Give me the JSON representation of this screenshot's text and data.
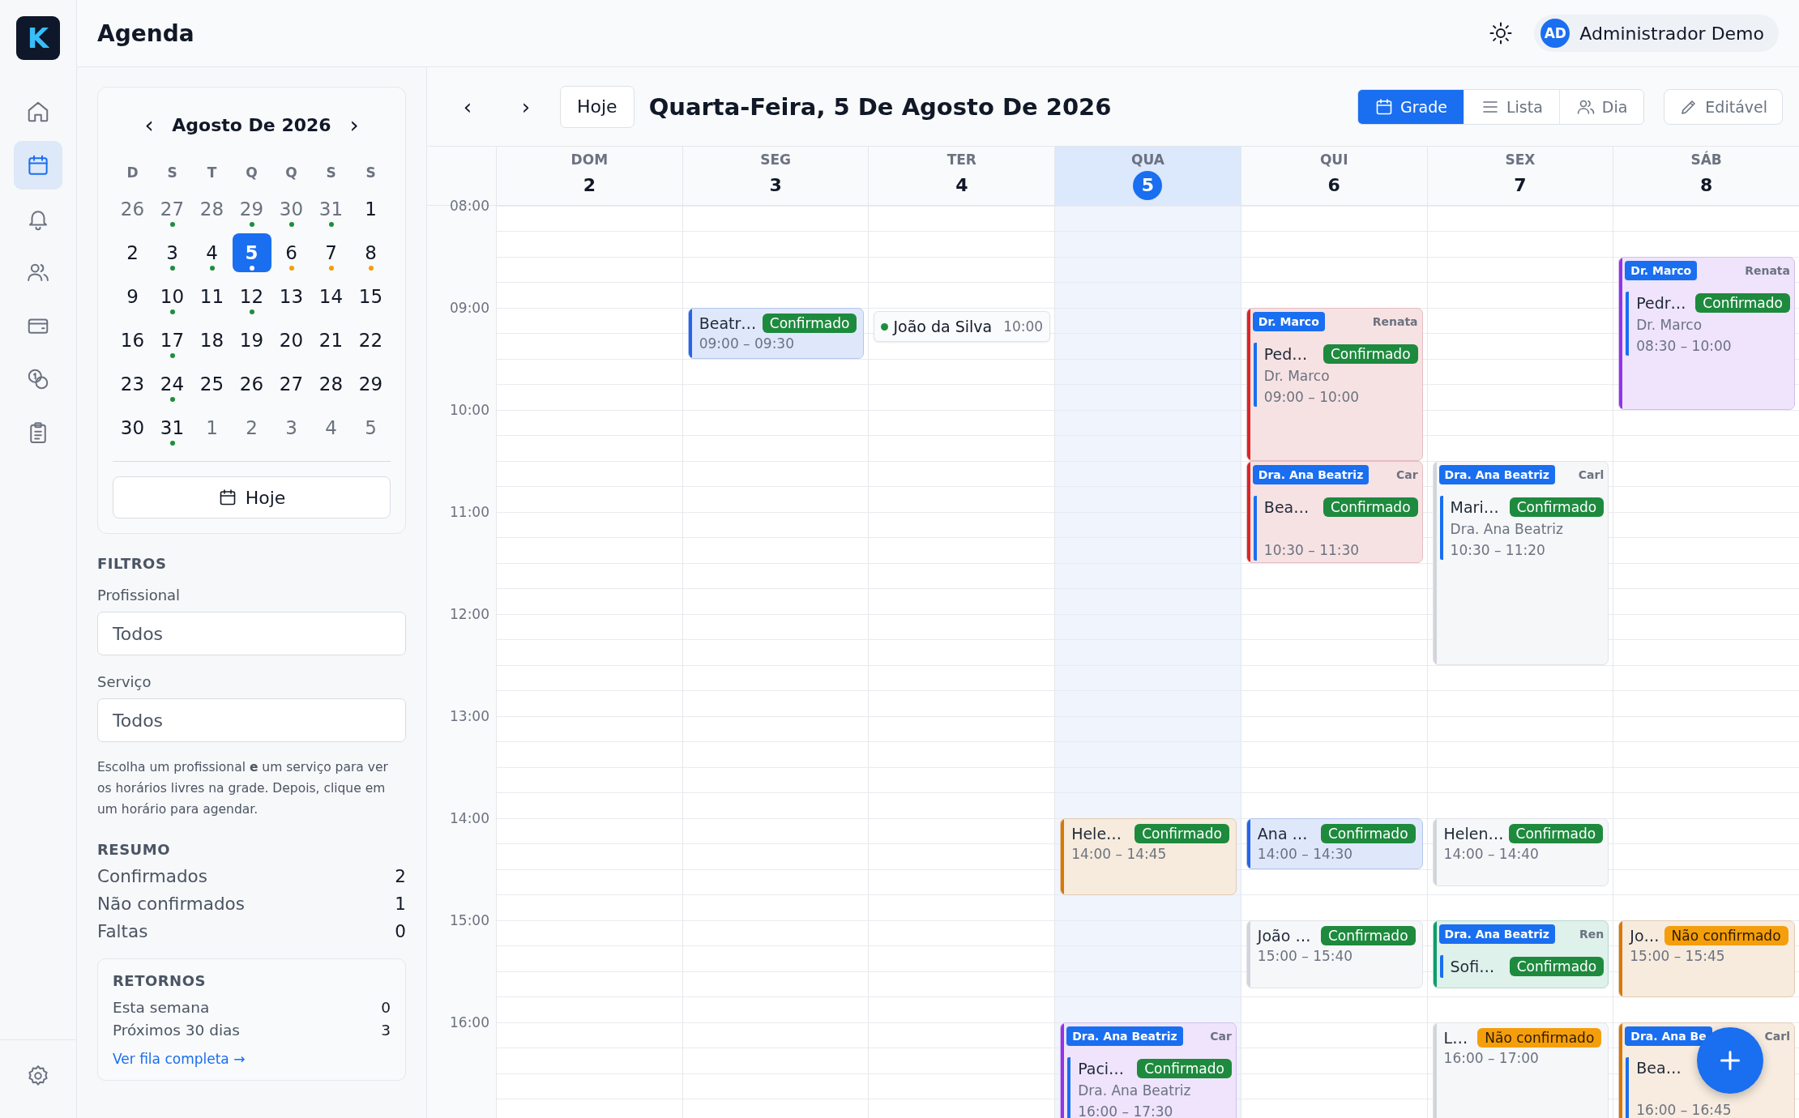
{
  "app": {
    "logo": "K",
    "title": "Agenda"
  },
  "nav": [
    {
      "kind": "home",
      "selected": false
    },
    {
      "kind": "calendar",
      "selected": true
    },
    {
      "kind": "bell",
      "selected": false
    },
    {
      "kind": "users",
      "selected": false
    },
    {
      "kind": "wallet",
      "selected": false
    },
    {
      "kind": "coins",
      "selected": false
    },
    {
      "kind": "clipboard",
      "selected": false
    },
    {
      "kind": "settings",
      "selected": false
    }
  ],
  "user": {
    "initials": "AD",
    "name": "Administrador Demo"
  },
  "mini_calendar": {
    "title": "Agosto De 2026",
    "prev": "‹",
    "next": "›",
    "weekdays": [
      "D",
      "S",
      "T",
      "Q",
      "Q",
      "S",
      "S"
    ],
    "days": [
      {
        "label": "26",
        "muted": true,
        "selected": false
      },
      {
        "label": "27",
        "muted": true,
        "selected": false,
        "color": "#1e8e3e"
      },
      {
        "label": "28",
        "muted": true,
        "selected": false
      },
      {
        "label": "29",
        "muted": true,
        "selected": false,
        "color": "#1e8e3e"
      },
      {
        "label": "30",
        "muted": true,
        "selected": false,
        "color": "#1e8e3e"
      },
      {
        "label": "31",
        "muted": true,
        "selected": false,
        "color": "#1e8e3e"
      },
      {
        "label": "1",
        "muted": false,
        "selected": false
      },
      {
        "label": "2",
        "muted": false,
        "selected": false
      },
      {
        "label": "3",
        "muted": false,
        "selected": false,
        "color": "#1e8e3e"
      },
      {
        "label": "4",
        "muted": false,
        "selected": false,
        "color": "#1e8e3e"
      },
      {
        "label": "5",
        "muted": false,
        "selected": true,
        "color": "#ffffff"
      },
      {
        "label": "6",
        "muted": false,
        "selected": false,
        "color": "#f59e0b"
      },
      {
        "label": "7",
        "muted": false,
        "selected": false,
        "color": "#f59e0b"
      },
      {
        "label": "8",
        "muted": false,
        "selected": false,
        "color": "#f59e0b"
      },
      {
        "label": "9",
        "muted": false,
        "selected": false
      },
      {
        "label": "10",
        "muted": false,
        "selected": false,
        "color": "#1e8e3e"
      },
      {
        "label": "11",
        "muted": false,
        "selected": false
      },
      {
        "label": "12",
        "muted": false,
        "selected": false,
        "color": "#1e8e3e"
      },
      {
        "label": "13",
        "muted": false,
        "selected": false
      },
      {
        "label": "14",
        "muted": false,
        "selected": false
      },
      {
        "label": "15",
        "muted": false,
        "selected": false
      },
      {
        "label": "16",
        "muted": false,
        "selected": false
      },
      {
        "label": "17",
        "muted": false,
        "selected": false,
        "color": "#1e8e3e"
      },
      {
        "label": "18",
        "muted": false,
        "selected": false
      },
      {
        "label": "19",
        "muted": false,
        "selected": false
      },
      {
        "label": "20",
        "muted": false,
        "selected": false
      },
      {
        "label": "21",
        "muted": false,
        "selected": false
      },
      {
        "label": "22",
        "muted": false,
        "selected": false
      },
      {
        "label": "23",
        "muted": false,
        "selected": false
      },
      {
        "label": "24",
        "muted": false,
        "selected": false,
        "color": "#1e8e3e"
      },
      {
        "label": "25",
        "muted": false,
        "selected": false
      },
      {
        "label": "26",
        "muted": false,
        "selected": false
      },
      {
        "label": "27",
        "muted": false,
        "selected": false
      },
      {
        "label": "28",
        "muted": false,
        "selected": false
      },
      {
        "label": "29",
        "muted": false,
        "selected": false
      },
      {
        "label": "30",
        "muted": false,
        "selected": false
      },
      {
        "label": "31",
        "muted": false,
        "selected": false,
        "color": "#1e8e3e"
      },
      {
        "label": "1",
        "muted": true,
        "selected": false
      },
      {
        "label": "2",
        "muted": true,
        "selected": false
      },
      {
        "label": "3",
        "muted": true,
        "selected": false
      },
      {
        "label": "4",
        "muted": true,
        "selected": false
      },
      {
        "label": "5",
        "muted": true,
        "selected": false
      }
    ],
    "today_button": "Hoje"
  },
  "filters": {
    "title": "FILTROS",
    "fields": [
      {
        "label": "Profissional",
        "value": "Todos"
      },
      {
        "label": "Serviço",
        "value": "Todos"
      }
    ],
    "hint": "Escolha um profissional **e** um serviço para ver os horários livres na grade. Depois, clique em um horário para agendar."
  },
  "summary": {
    "title": "RESUMO",
    "rows": [
      {
        "label": "Confirmados",
        "value": "2"
      },
      {
        "label": "Não confirmados",
        "value": "1"
      },
      {
        "label": "Faltas",
        "value": "0"
      }
    ]
  },
  "returns": {
    "title": "RETORNOS",
    "rows": [
      {
        "label": "Esta semana",
        "value": "0"
      },
      {
        "label": "Próximos 30 dias",
        "value": "3"
      }
    ],
    "link": "Ver fila completa →"
  },
  "toolbar": {
    "prev": "‹",
    "next": "›",
    "today": "Hoje",
    "title": "Quarta-Feira, 5 De Agosto De 2026",
    "views": [
      {
        "kind": "calendar",
        "label": "Grade",
        "selected": true
      },
      {
        "kind": "list",
        "label": "Lista",
        "selected": false
      },
      {
        "kind": "users",
        "label": "Dia",
        "selected": false
      }
    ],
    "edit": "Editável"
  },
  "week": {
    "hours": [
      "08:00",
      "09:00",
      "10:00",
      "11:00",
      "12:00",
      "13:00",
      "14:00",
      "15:00",
      "16:00"
    ],
    "days": [
      {
        "name": "DOM",
        "number": "2",
        "selected": false
      },
      {
        "name": "SEG",
        "number": "3",
        "selected": false,
        "events": [
          {
            "kind": "event",
            "title": "Beatr…",
            "status": {
              "label": "Confirmado",
              "kind": "confirmed"
            },
            "time": "09:00 – 09:30",
            "color": "#2563eb"
          }
        ]
      },
      {
        "name": "TER",
        "number": "4",
        "selected": false,
        "events": [
          {
            "kind": "pill",
            "title": "João da Silva",
            "time": "10:00",
            "color": "#1e8e3e"
          }
        ]
      },
      {
        "name": "QUA",
        "number": "5",
        "selected": true,
        "events": [
          {
            "kind": "event",
            "title": "Hele…",
            "status": {
              "label": "Confirmado",
              "kind": "confirmed"
            },
            "time": "14:00 – 14:45",
            "color": "#d97706"
          },
          {
            "kind": "group",
            "color": "#9333ea",
            "professional": "Dra. Ana Beatriz",
            "assistant": "Car",
            "event": {
              "title": "Paci…",
              "status": {
                "label": "Confirmado",
                "kind": "confirmed"
              },
              "professional": "Dra. Ana Beatriz",
              "time": "16:00 – 17:30"
            }
          }
        ]
      },
      {
        "name": "QUI",
        "number": "6",
        "selected": false,
        "events": [
          {
            "kind": "group",
            "color": "#dc2626",
            "professional": "Dr. Marco",
            "assistant": "Renata",
            "event": {
              "title": "Ped…",
              "status": {
                "label": "Confirmado",
                "kind": "confirmed"
              },
              "professional": "Dr. Marco",
              "time": "09:00 – 10:00"
            }
          },
          {
            "kind": "group",
            "color": "#dc2626",
            "professional": "Dra. Ana Beatriz",
            "assistant": "Car",
            "event": {
              "title": "Bea…",
              "status": {
                "label": "Confirmado",
                "kind": "confirmed"
              },
              "time": "10:30 – 11:30"
            }
          },
          {
            "kind": "event",
            "title": "Ana …",
            "status": {
              "label": "Confirmado",
              "kind": "confirmed"
            },
            "time": "14:00 – 14:30",
            "color": "#2563eb"
          },
          {
            "kind": "event",
            "title": "João …",
            "status": {
              "label": "Confirmado",
              "kind": "confirmed"
            },
            "time": "15:00 – 15:40",
            "color": "#d1d5db"
          }
        ]
      },
      {
        "name": "SEX",
        "number": "7",
        "selected": false,
        "events": [
          {
            "kind": "group",
            "color": "#d1d5db",
            "professional": "Dra. Ana Beatriz",
            "assistant": "Carl",
            "event": {
              "title": "Mari…",
              "status": {
                "label": "Confirmado",
                "kind": "confirmed"
              },
              "professional": "Dra. Ana Beatriz",
              "time": "10:30 – 11:20"
            }
          },
          {
            "kind": "event",
            "title": "Helen…",
            "status": {
              "label": "Confirmado",
              "kind": "confirmed"
            },
            "time": "14:00 – 14:40",
            "color": "#d1d5db"
          },
          {
            "kind": "group",
            "color": "#0f9d6b",
            "professional": "Dra. Ana Beatriz",
            "assistant": "Ren",
            "event": {
              "title": "Sofi…",
              "status": {
                "label": "Confirmado",
                "kind": "confirmed"
              }
            }
          },
          {
            "kind": "event",
            "title": "L…",
            "status": {
              "label": "Não confirmado",
              "kind": "pending"
            },
            "time": "16:00 – 17:00",
            "color": "#d1d5db"
          }
        ]
      },
      {
        "name": "SÁB",
        "number": "8",
        "selected": false,
        "events": [
          {
            "kind": "group",
            "color": "#9333ea",
            "professional": "Dr. Marco",
            "assistant": "Renata",
            "event": {
              "title": "Pedr…",
              "status": {
                "label": "Confirmado",
                "kind": "confirmed"
              },
              "professional": "Dr. Marco",
              "time": "08:30 – 10:00"
            }
          },
          {
            "kind": "event",
            "title": "Jo…",
            "status": {
              "label": "Não confirmado",
              "kind": "pending"
            },
            "time": "15:00 – 15:45",
            "color": "#d97706"
          },
          {
            "kind": "group",
            "color": "#d97706",
            "professional": "Dra. Ana Be",
            "assistant": "Carl",
            "event": {
              "title": "Bea…",
              "time": "16:00 – 16:45"
            }
          }
        ]
      }
    ]
  }
}
